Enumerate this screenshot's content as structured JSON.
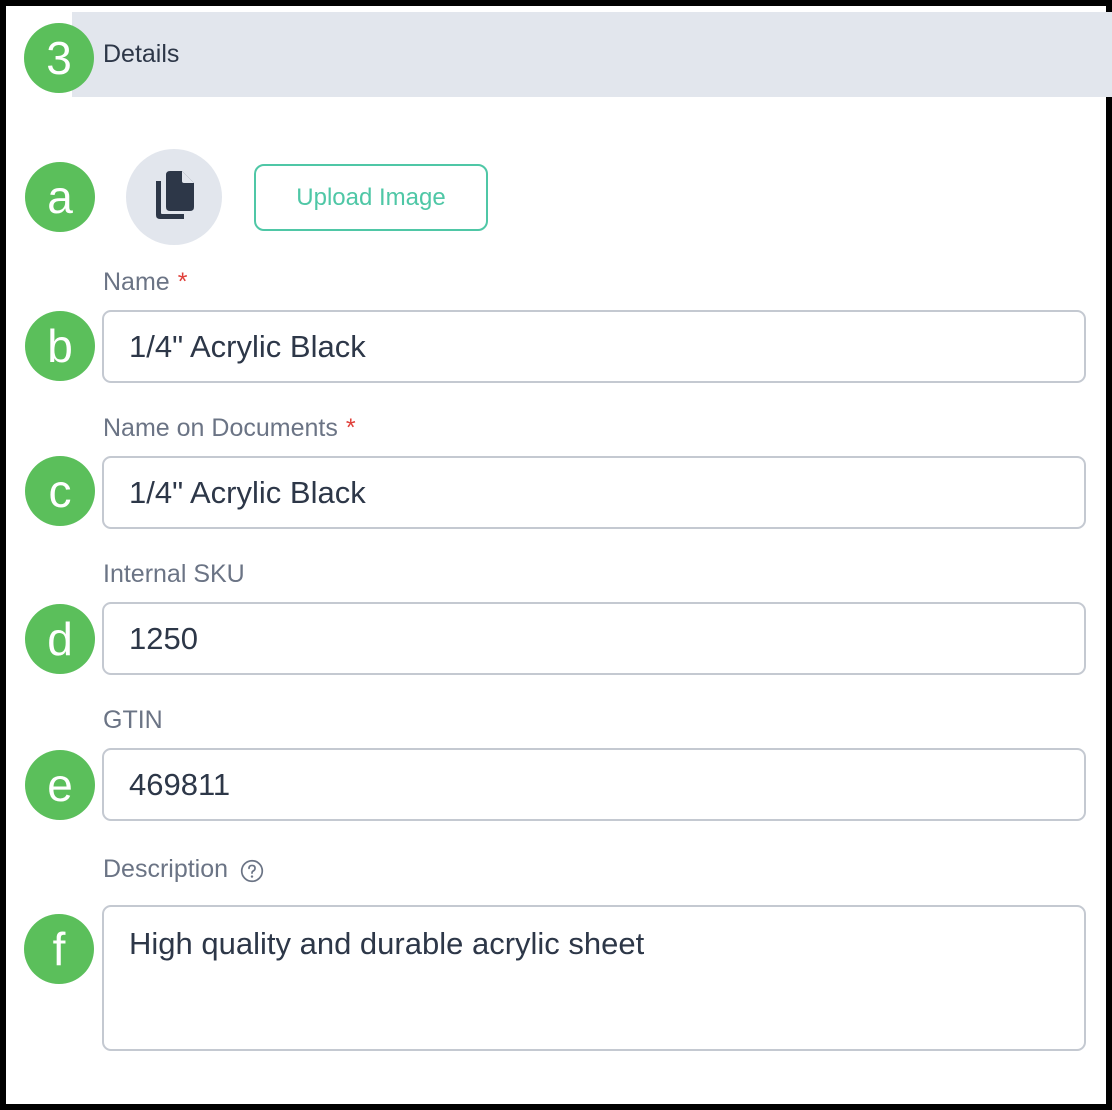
{
  "section": {
    "step_marker": "3",
    "title": "Details"
  },
  "markers": {
    "a": "a",
    "b": "b",
    "c": "c",
    "d": "d",
    "e": "e",
    "f": "f"
  },
  "image": {
    "icon": "documents-icon",
    "upload_label": "Upload Image"
  },
  "fields": {
    "name": {
      "label": "Name",
      "required_mark": "*",
      "value": "1/4\" Acrylic Black"
    },
    "name_on_documents": {
      "label": "Name on Documents",
      "required_mark": "*",
      "value": "1/4\" Acrylic Black"
    },
    "internal_sku": {
      "label": "Internal SKU",
      "value": "1250"
    },
    "gtin": {
      "label": "GTIN",
      "value": "469811"
    },
    "description": {
      "label": "Description",
      "help_icon": "question-circle-icon",
      "value": "High quality and durable acrylic sheet"
    }
  },
  "colors": {
    "marker": "#5bbf5b",
    "accent": "#4fc7a6",
    "required": "#e0403a",
    "header_bg": "#e2e6ed"
  }
}
